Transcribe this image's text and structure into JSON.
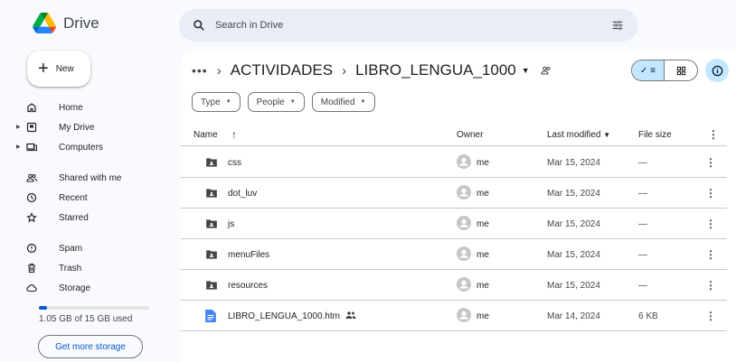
{
  "app": {
    "name": "Drive"
  },
  "sidebar": {
    "new_label": "New",
    "items": [
      {
        "label": "Home",
        "icon": "home-icon"
      },
      {
        "label": "My Drive",
        "icon": "my-drive-icon",
        "expandable": true
      },
      {
        "label": "Computers",
        "icon": "computers-icon",
        "expandable": true
      },
      {
        "label": "Shared with me",
        "icon": "shared-with-me-icon"
      },
      {
        "label": "Recent",
        "icon": "recent-icon"
      },
      {
        "label": "Starred",
        "icon": "star-icon"
      },
      {
        "label": "Spam",
        "icon": "spam-icon"
      },
      {
        "label": "Trash",
        "icon": "trash-icon"
      },
      {
        "label": "Storage",
        "icon": "cloud-icon"
      }
    ],
    "storage_text": "1.05 GB of 15 GB used",
    "storage_used_fraction": 0.07,
    "get_storage_label": "Get more storage"
  },
  "search": {
    "placeholder": "Search in Drive"
  },
  "breadcrumb": {
    "overflow": "•••",
    "separator": "›",
    "items": [
      "ACTIVIDADES",
      "LIBRO_LENGUA_1000"
    ]
  },
  "view": {
    "mode": "list"
  },
  "filters": [
    "Type",
    "People",
    "Modified"
  ],
  "table": {
    "headers": {
      "name": "Name",
      "owner": "Owner",
      "modified": "Last modified",
      "size": "File size"
    },
    "rows": [
      {
        "type": "folder",
        "name": "css",
        "owner": "me",
        "modified": "Mar 15, 2024",
        "size": "—"
      },
      {
        "type": "folder",
        "name": "dot_luv",
        "owner": "me",
        "modified": "Mar 15, 2024",
        "size": "—"
      },
      {
        "type": "folder",
        "name": "js",
        "owner": "me",
        "modified": "Mar 15, 2024",
        "size": "—"
      },
      {
        "type": "folder",
        "name": "menuFiles",
        "owner": "me",
        "modified": "Mar 15, 2024",
        "size": "—"
      },
      {
        "type": "folder",
        "name": "resources",
        "owner": "me",
        "modified": "Mar 15, 2024",
        "size": "—"
      },
      {
        "type": "file",
        "name": "LIBRO_LENGUA_1000.htm",
        "owner": "me",
        "modified": "Mar 14, 2024",
        "size": "6 KB",
        "shared": true
      }
    ]
  },
  "colors": {
    "accent": "#0b57d0",
    "selected": "#c2e7ff",
    "folder": "#444746",
    "doc": "#4285f4"
  }
}
